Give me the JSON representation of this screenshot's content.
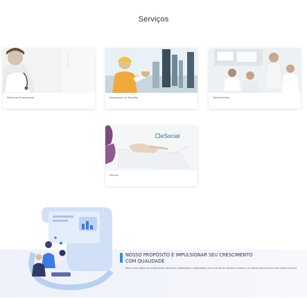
{
  "section": {
    "title": "Serviços"
  },
  "cards": [
    {
      "label": "Medicina Ocupacional"
    },
    {
      "label": "Segurança no Trabalho"
    },
    {
      "label": "Treinamentos"
    },
    {
      "label": "eSocial",
      "logo_text": "eSocial"
    }
  ],
  "purpose": {
    "heading": "NOSSO PROPÓSITO É IMPULSIONAR SEU CRESCIMENTO COM QUALIDADE",
    "body": "Nossa nova equipe de profissionais altamente qualificados e capacitados com o intuito de atender e adquirir um melhor atendimento para nossos clientes"
  },
  "colors": {
    "accent": "#2f8fd8",
    "esocial_blue": "#2e6a8e",
    "esocial_green": "#2f9a48",
    "band": "#eef1fa"
  },
  "icons": [
    "esocial-leaf-icon",
    "accent-marker"
  ]
}
